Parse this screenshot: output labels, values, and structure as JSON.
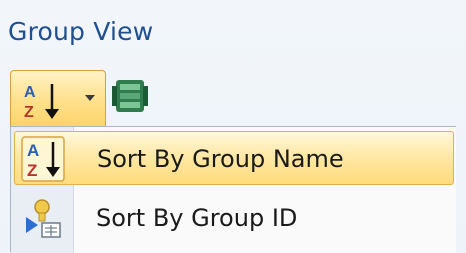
{
  "panel": {
    "title": "Group View"
  },
  "toolbar": {
    "sort_button_icon": "sort-az-icon",
    "dropdown_icon": "chevron-down-icon",
    "group_icon": "group-view-icon"
  },
  "menu": {
    "items": [
      {
        "label": "Sort By Group Name",
        "icon": "sort-az-icon",
        "highlighted": true
      },
      {
        "label": "Sort By Group ID",
        "icon": "sort-by-id-icon",
        "highlighted": false
      }
    ]
  },
  "colors": {
    "title_text": "#1e4f91",
    "highlight_top": "#fff8dc",
    "highlight_bottom": "#ffdb7b",
    "highlight_border": "#e3b04c"
  }
}
